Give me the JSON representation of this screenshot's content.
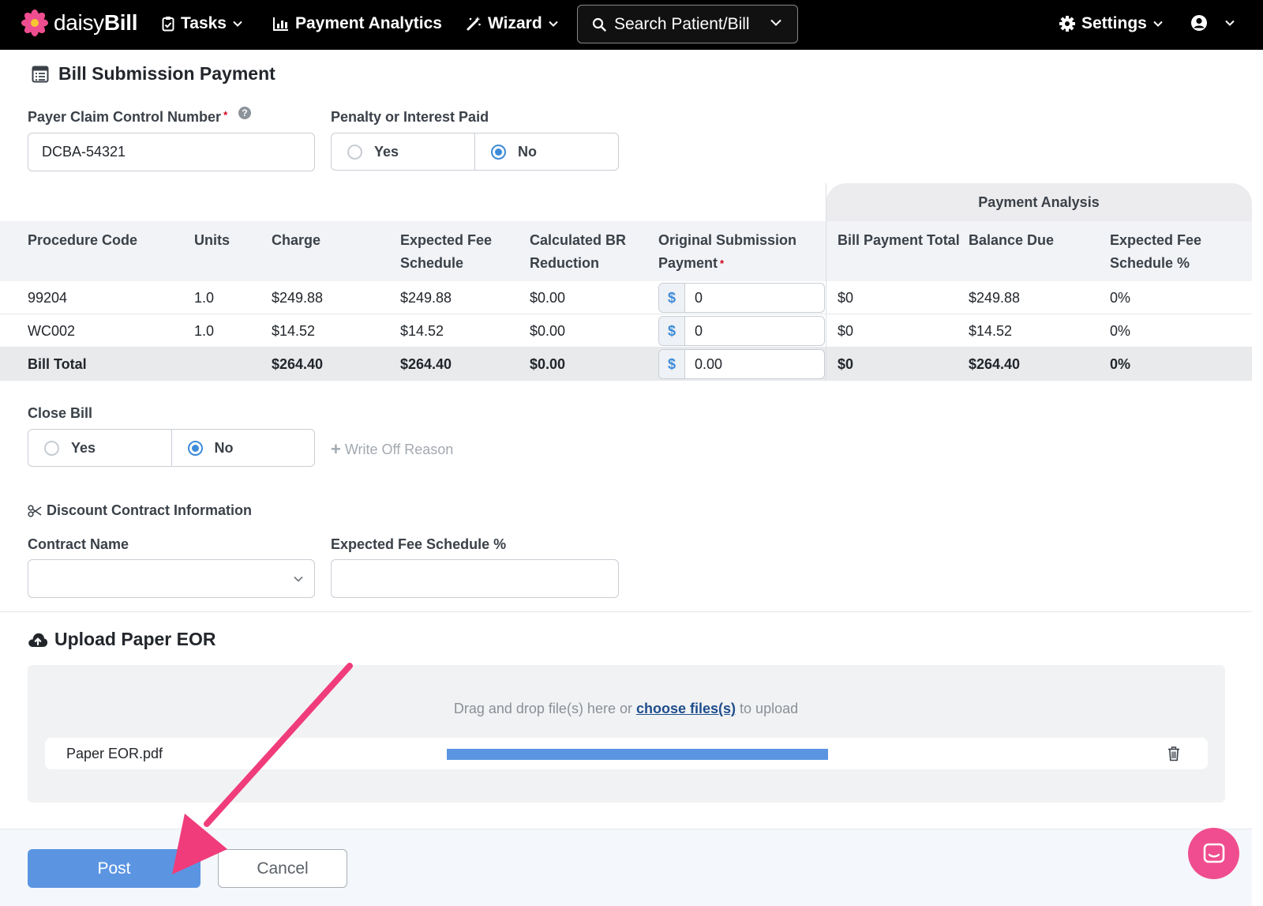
{
  "brand": {
    "name_light": "daisy",
    "name_bold": "Bill"
  },
  "nav": {
    "tasks": "Tasks",
    "payment_analytics": "Payment Analytics",
    "wizard": "Wizard",
    "search": "Search Patient/Bill",
    "settings": "Settings"
  },
  "section_title": "Bill Submission Payment",
  "claim_control": {
    "label": "Payer Claim Control Number",
    "required": "*",
    "help": "?",
    "value": "DCBA-54321"
  },
  "penalty": {
    "label": "Penalty or Interest Paid",
    "options": [
      "Yes",
      "No"
    ],
    "selected": "No"
  },
  "table": {
    "group_header": "Payment Analysis",
    "columns": [
      "Procedure Code",
      "Units",
      "Charge",
      "Expected Fee Schedule",
      "Calculated BR Reduction",
      "Original Submission Payment",
      "Bill Payment Total",
      "Balance Due",
      "Expected Fee Schedule %"
    ],
    "required_mark": "*",
    "currency_symbol": "$",
    "rows": [
      {
        "code": "99204",
        "units": "1.0",
        "charge": "$249.88",
        "expected": "$249.88",
        "br": "$0.00",
        "payment": "0",
        "total": "$0",
        "balance": "$249.88",
        "pct": "0%"
      },
      {
        "code": "WC002",
        "units": "1.0",
        "charge": "$14.52",
        "expected": "$14.52",
        "br": "$0.00",
        "payment": "0",
        "total": "$0",
        "balance": "$14.52",
        "pct": "0%"
      }
    ],
    "totals": {
      "code": "Bill Total",
      "charge": "$264.40",
      "expected": "$264.40",
      "br": "$0.00",
      "payment": "0.00",
      "total": "$0",
      "balance": "$264.40",
      "pct": "0%"
    }
  },
  "close_bill": {
    "label": "Close Bill",
    "options": [
      "Yes",
      "No"
    ],
    "selected": "No",
    "write_off": "Write Off Reason"
  },
  "discount": {
    "title": "Discount Contract Information",
    "contract_label": "Contract Name",
    "contract_value": "",
    "fee_pct_label": "Expected Fee Schedule %",
    "fee_pct_value": ""
  },
  "upload": {
    "title": "Upload Paper EOR",
    "drop_prefix": "Drag and drop file(s) here or",
    "drop_link": "choose files(s)",
    "drop_suffix": "to upload",
    "file_name": "Paper EOR.pdf",
    "progress": 1.0
  },
  "actions": {
    "post": "Post",
    "cancel": "Cancel"
  },
  "colors": {
    "accent": "#5b95e2",
    "brand_pink": "#ef4d8f",
    "required": "#d0021b",
    "annotation_arrow": "#f03c7a"
  }
}
